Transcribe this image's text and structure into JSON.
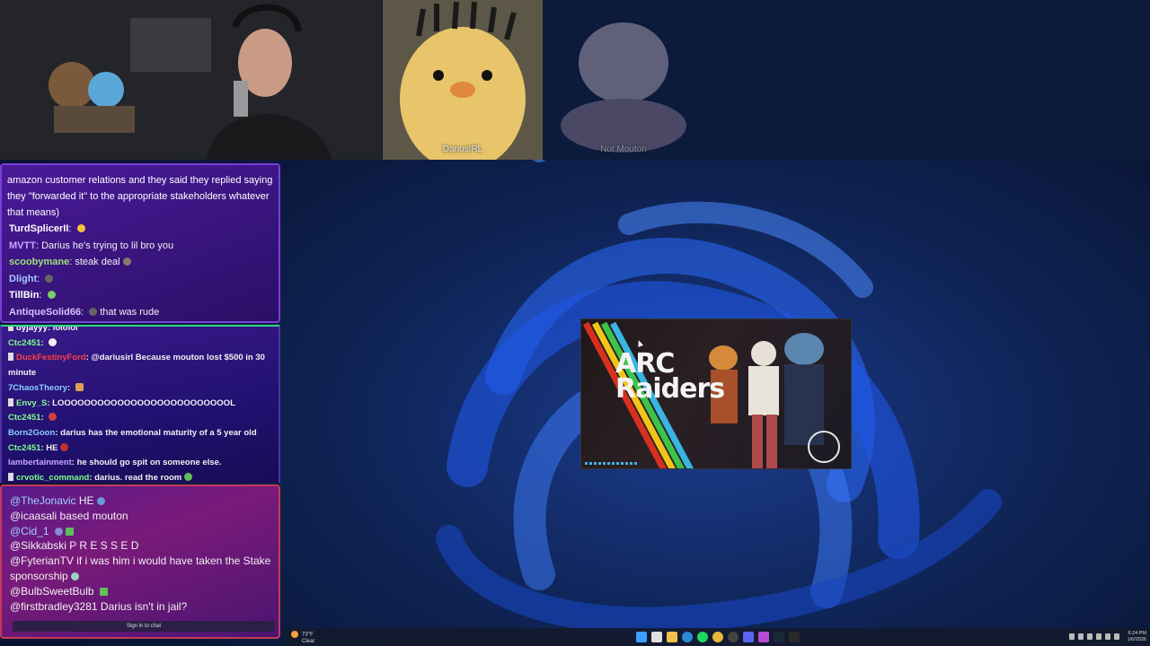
{
  "webcams": {
    "main": {
      "label": ""
    },
    "guest1": {
      "label": "DariusIRL"
    },
    "guest2": {
      "label": "Not Mouton"
    }
  },
  "chat1": {
    "messages": [
      {
        "user": "",
        "text": "amazon customer relations and they said they replied saying they \"forwarded it\" to the appropriate stakeholders whatever that means)",
        "color": "#ffffff"
      },
      {
        "user": "TurdSplicerII",
        "text": "",
        "color": "#ffffff"
      },
      {
        "user": "MVTT",
        "text": "Darius he's trying to lil bro you",
        "color": "#c9a6ff"
      },
      {
        "user": "scoobymane",
        "text": "steak deal",
        "color": "#9fe07a"
      },
      {
        "user": "Dlight",
        "text": "",
        "color": "#a6c8ff"
      },
      {
        "user": "TillBin",
        "text": "",
        "color": "#ffffff"
      },
      {
        "user": "AntiqueSolid66",
        "text": "that was rude",
        "color": "#d6c2ff"
      }
    ]
  },
  "chat2": {
    "messages": [
      {
        "user": "dyjayyy",
        "text": "lololol",
        "color": "#ffffff"
      },
      {
        "user": "Ctc2451",
        "text": "",
        "color": "#7dff8a"
      },
      {
        "user": "DuckFestinyFord",
        "text": "@dariusirl Because mouton lost $500 in 30 minute",
        "color": "#ff4040"
      },
      {
        "user": "7ChaosTheory",
        "text": "",
        "color": "#8ad1ff"
      },
      {
        "user": "Envy_S",
        "text": "LOOOOOOOOOOOOOOOOOOOOOOOOOOL",
        "color": "#7dff8a"
      },
      {
        "user": "Ctc2451",
        "text": "",
        "color": "#7dff8a"
      },
      {
        "user": "Born2Goon",
        "text": "darius has the emotional maturity of a 5 year old",
        "color": "#8ad1ff"
      },
      {
        "user": "Ctc2451",
        "text": "HE",
        "color": "#7dff8a"
      },
      {
        "user": "lambertainment",
        "text": "he should go spit on someone else.",
        "color": "#c9a6ff"
      },
      {
        "user": "crvotic_command",
        "text": "darius. read the room",
        "color": "#7dff8a"
      }
    ]
  },
  "chat3": {
    "messages": [
      {
        "user": "@TheJonavic",
        "text": "HE",
        "color": "#9fd0ff"
      },
      {
        "user": "@icaasali",
        "text": "based mouton",
        "color": "#ffffff"
      },
      {
        "user": "@Cid_1",
        "text": "",
        "color": "#9fd0ff"
      },
      {
        "user": "@Sikkabski",
        "text": "P R E S S E D",
        "color": "#ffffff"
      },
      {
        "user": "@FyterianTV",
        "text": "if i was him i would have taken the Stake sponsorship",
        "color": "#ffffff"
      },
      {
        "user": "@BulbSweetBulb",
        "text": "",
        "color": "#ffffff"
      },
      {
        "user": "@firstbradley3281",
        "text": "Darius isn't in jail?",
        "color": "#ffffff"
      }
    ],
    "signin_label": "Sign in to chat"
  },
  "game_window": {
    "title_line1": "ARC",
    "title_line2": "Raiders"
  },
  "taskbar": {
    "weather_temp": "73°F",
    "weather_desc": "Clear",
    "time": "6:24 PM",
    "date": "1/6/2026",
    "pinned": [
      "start-icon",
      "search-icon",
      "file-explorer-icon",
      "edge-icon",
      "spotify-icon",
      "chrome-icon",
      "obs-icon",
      "discord-icon",
      "steam-icon",
      "terminal-icon",
      "app-icon"
    ]
  }
}
